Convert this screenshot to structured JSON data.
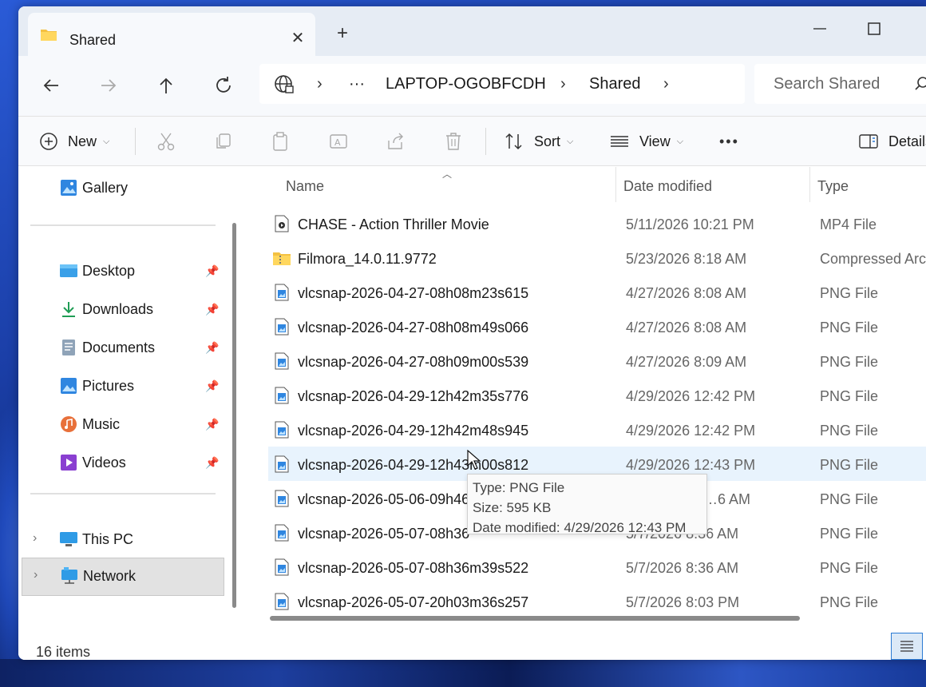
{
  "window": {
    "tab_title": "Shared",
    "new_tab_label": "+",
    "close_label": "✕"
  },
  "address": {
    "overflow": "···",
    "crumbs": [
      "LAPTOP-OGOBFCDH",
      "Shared"
    ],
    "search_placeholder": "Search Shared"
  },
  "commands": {
    "new_label": "New",
    "sort_label": "Sort",
    "view_label": "View",
    "more_label": "•••",
    "details_label": "Details"
  },
  "sidebar": {
    "gallery": "Gallery",
    "pinned": [
      {
        "label": "Desktop",
        "icon": "desktop-icon"
      },
      {
        "label": "Downloads",
        "icon": "downloads-icon"
      },
      {
        "label": "Documents",
        "icon": "documents-icon"
      },
      {
        "label": "Pictures",
        "icon": "pictures-icon"
      },
      {
        "label": "Music",
        "icon": "music-icon"
      },
      {
        "label": "Videos",
        "icon": "videos-icon"
      }
    ],
    "this_pc": "This PC",
    "network": "Network"
  },
  "columns": {
    "name": "Name",
    "date": "Date modified",
    "type": "Type"
  },
  "files": [
    {
      "name": "CHASE - Action Thriller Movie",
      "date": "5/11/2026 10:21 PM",
      "type": "MP4 File",
      "icon": "video-file-icon"
    },
    {
      "name": "Filmora_14.0.11.9772",
      "date": "5/23/2026 8:18 AM",
      "type": "Compressed Archive",
      "icon": "zip-folder-icon"
    },
    {
      "name": "vlcsnap-2026-04-27-08h08m23s615",
      "date": "4/27/2026 8:08 AM",
      "type": "PNG File",
      "icon": "png-file-icon"
    },
    {
      "name": "vlcsnap-2026-04-27-08h08m49s066",
      "date": "4/27/2026 8:08 AM",
      "type": "PNG File",
      "icon": "png-file-icon"
    },
    {
      "name": "vlcsnap-2026-04-27-08h09m00s539",
      "date": "4/27/2026 8:09 AM",
      "type": "PNG File",
      "icon": "png-file-icon"
    },
    {
      "name": "vlcsnap-2026-04-29-12h42m35s776",
      "date": "4/29/2026 12:42 PM",
      "type": "PNG File",
      "icon": "png-file-icon"
    },
    {
      "name": "vlcsnap-2026-04-29-12h42m48s945",
      "date": "4/29/2026 12:42 PM",
      "type": "PNG File",
      "icon": "png-file-icon"
    },
    {
      "name": "vlcsnap-2026-04-29-12h43m00s812",
      "date": "4/29/2026 12:43 PM",
      "type": "PNG File",
      "icon": "png-file-icon"
    },
    {
      "name": "vlcsnap-2026-05-06-09h46",
      "date": "…6 AM",
      "type": "PNG File",
      "icon": "png-file-icon"
    },
    {
      "name": "vlcsnap-2026-05-07-08h36",
      "date": "5/7/2026 8:36 AM",
      "type": "PNG File",
      "icon": "png-file-icon"
    },
    {
      "name": "vlcsnap-2026-05-07-08h36m39s522",
      "date": "5/7/2026 8:36 AM",
      "type": "PNG File",
      "icon": "png-file-icon"
    },
    {
      "name": "vlcsnap-2026-05-07-20h03m36s257",
      "date": "5/7/2026 8:03 PM",
      "type": "PNG File",
      "icon": "png-file-icon"
    }
  ],
  "tooltip": {
    "type_line": "Type: PNG File",
    "size_line": "Size: 595 KB",
    "date_line": "Date modified: 4/29/2026 12:43 PM"
  },
  "status": {
    "item_count": "16 items"
  },
  "colors": {
    "accent": "#2b7bd3",
    "hover_row": "#e8f3fd"
  }
}
